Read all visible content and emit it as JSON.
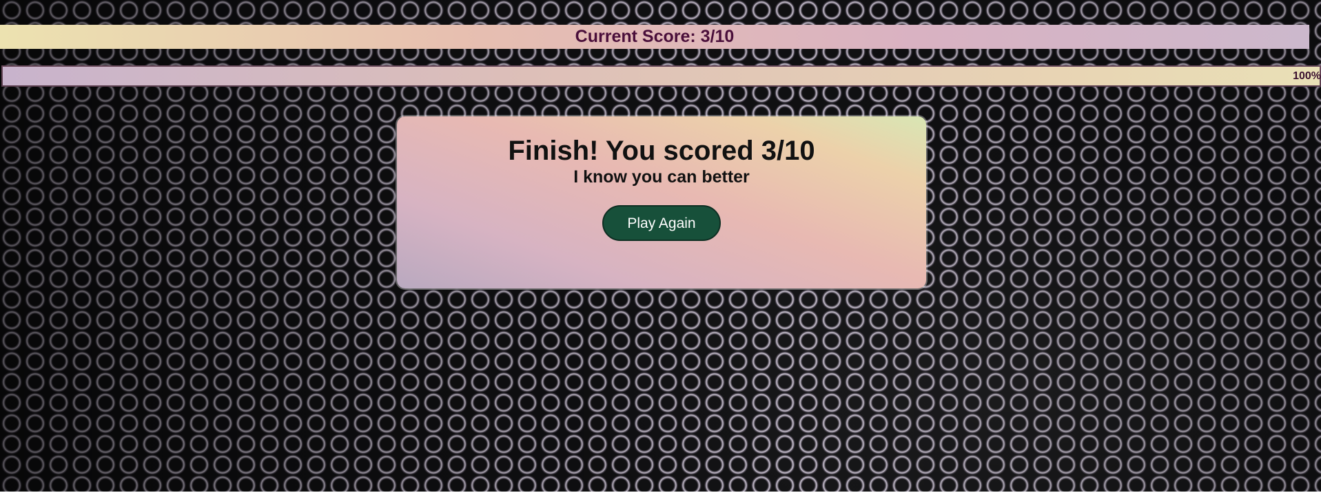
{
  "header": {
    "score_text": "Current Score: 3/10"
  },
  "progress": {
    "value_percent": 100,
    "label": "100%"
  },
  "result": {
    "title": "Finish! You scored 3/10",
    "subtitle": "I know you can better",
    "play_again_label": "Play Again"
  },
  "colors": {
    "score_text": "#4a0f3a",
    "button_bg": "#17503a",
    "button_text": "#ffffff"
  }
}
